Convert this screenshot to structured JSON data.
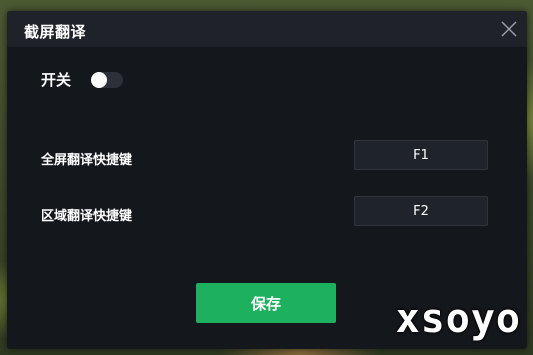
{
  "dialog": {
    "title": "截屏翻译",
    "close_icon": "close-icon"
  },
  "toggle": {
    "label": "开关",
    "state": "off"
  },
  "hotkeys": [
    {
      "label": "全屏翻译快捷键",
      "key": "F1"
    },
    {
      "label": "区域翻译快捷键",
      "key": "F2"
    }
  ],
  "save_label": "保存",
  "watermark": "xsoyo",
  "colors": {
    "dialog_bg": "#14171c",
    "titlebar_bg": "#1f2329",
    "accent_green": "#1db05e"
  }
}
